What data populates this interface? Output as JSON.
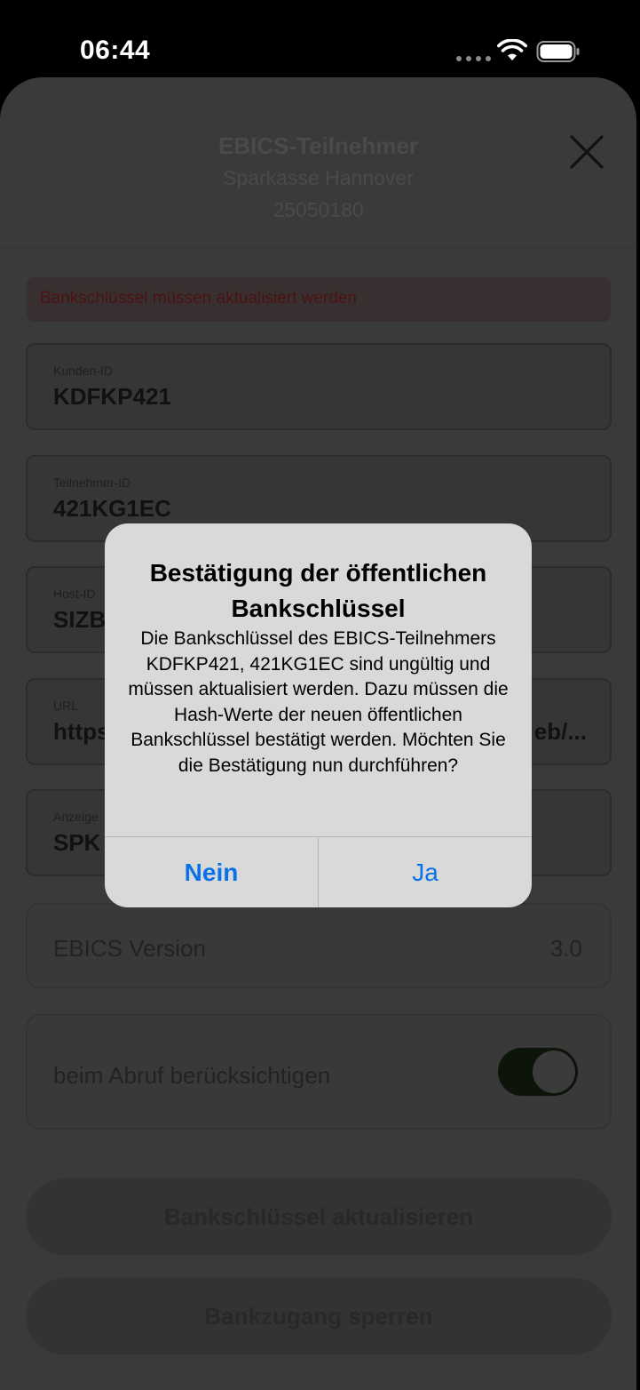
{
  "status_bar": {
    "time": "06:44"
  },
  "header": {
    "title": "EBICS-Teilnehmer",
    "bank_name": "Sparkasse Hannover",
    "blz": "25050180"
  },
  "warning": "Bankschlüssel müssen aktualisiert werden",
  "fields": {
    "kunden_id": {
      "label": "Kunden-ID",
      "value": "KDFKP421"
    },
    "teilnehmer_id": {
      "label": "Teilnehmer-ID",
      "value": "421KG1EC"
    },
    "host_id": {
      "label": "Host-ID",
      "value": "SIZB"
    },
    "url": {
      "label": "URL",
      "value": "https:",
      "value_tail": "eb/..."
    },
    "anzeige": {
      "label": "Anzeige",
      "value": "SPK"
    }
  },
  "ebics_version": {
    "label": "EBICS Version",
    "value": "3.0"
  },
  "abruf": {
    "label": "beim Abruf berücksichtigen",
    "enabled": true
  },
  "buttons": {
    "update_keys": "Bankschlüssel aktualisieren",
    "lock_access": "Bankzugang sperren"
  },
  "alert": {
    "title": "Bestätigung der öffentlichen Bankschlüssel",
    "message": "Die Bankschlüssel des EBICS-Teilnehmers KDFKP421, 421KG1EC sind ungültig und müssen aktualisiert werden. Dazu müssen die Hash-Werte der neuen öffentlichen Bankschlüssel bestätigt werden. Möchten Sie die Bestätigung nun durchführen?",
    "no_label": "Nein",
    "yes_label": "Ja"
  },
  "colors": {
    "accent": "#0a72e8",
    "toggle_on": "#0d140a",
    "warning_text": "#4c1212"
  },
  "icons": [
    "wifi-icon",
    "battery-icon",
    "close-icon"
  ]
}
